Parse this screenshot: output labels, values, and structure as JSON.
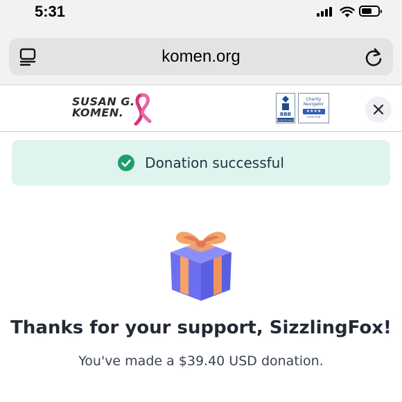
{
  "status_bar": {
    "time": "5:31",
    "icons": [
      "signal-icon",
      "wifi-icon",
      "battery-icon"
    ]
  },
  "browser": {
    "url": "komen.org",
    "icons": [
      "reader-icon",
      "reload-icon"
    ]
  },
  "site_header": {
    "logo_line1": "SUSAN G.",
    "logo_line2": "KOMEN.",
    "badges": {
      "bbb": "BBB",
      "bbb_sub": "ACCREDITED CHARITY",
      "charity_navigator_line1": "Charity",
      "charity_navigator_line2": "Navigator",
      "charity_navigator_rating": "FOUR-STAR"
    },
    "close_icon": "close-icon"
  },
  "banner": {
    "text": "Donation successful",
    "color": "#dff4ee",
    "check_color": "#1f9d6b"
  },
  "main": {
    "gift_icon": "gift-icon",
    "thanks": "Thanks for your support, SizzlingFox!",
    "donation_text": "You've made a $39.40 USD donation."
  },
  "colors": {
    "brand_pink": "#d6337c",
    "gift_body": "#6b6ff0",
    "gift_ribbon": "#f6a26b"
  }
}
